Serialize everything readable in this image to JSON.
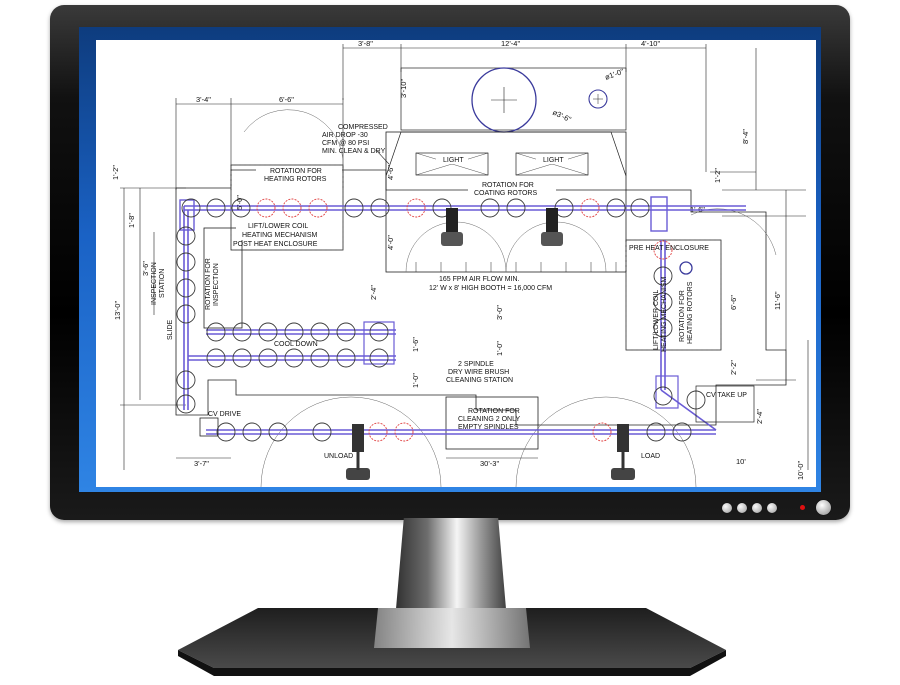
{
  "drawing": {
    "dims_top": [
      "3'-8\"",
      "12'-4\"",
      "4'-10\""
    ],
    "dims_second": [
      "3'-4\"",
      "6'-6\""
    ],
    "dims_circles": [
      "3'-10\"",
      "ø3'-6\"",
      "ø1'-0\""
    ],
    "dims_left": [
      "1'-2\"",
      "1'-8\"",
      "3'-6\"",
      "13'-0\"",
      "1'-6\"",
      "1'-0\""
    ],
    "dims_right": [
      "8'-4\"",
      "1'-2\"",
      "1'-6\"",
      "11'-6\"",
      "6'-6\"",
      "2'-2\"",
      "2'-4\"",
      "10'-0\""
    ],
    "dims_inner": [
      "5'-0\"",
      "4'-6\"",
      "4'-0\"",
      "2'-4\"",
      "3'-0\"",
      "1'-0\"",
      "10'"
    ],
    "dims_bottom": [
      "3'-7\"",
      "30'-3\""
    ],
    "compressed_air": [
      "COMPRESSED",
      "AIR DROP -30",
      "CFM @ 80 PSI",
      "MIN. CLEAN & DRY"
    ],
    "light_left": "LIGHT",
    "light_right": "LIGHT",
    "rotation_heating": [
      "ROTATION FOR",
      "HEATING ROTORS"
    ],
    "rotation_coating": [
      "ROTATION FOR",
      "COATING ROTORS"
    ],
    "lift_lower_left": [
      "LIFT/LOWER COIL",
      "HEATING MECHANISM"
    ],
    "post_heat": "POST HEAT ENCLOSURE",
    "pre_heat": "PRE HEAT ENCLOSURE",
    "airflow": [
      "165 FPM AIR FLOW MIN.",
      "12' W x 8' HIGH BOOTH = 16,000 CFM"
    ],
    "inspection_station": [
      "INSPECTION",
      "STATION"
    ],
    "rotation_inspection": [
      "ROTATION FOR",
      "INSPECTION"
    ],
    "slide": "SLIDE",
    "cool_down": "COOL DOWN",
    "lift_lower_right": [
      "LIFT/LOWER COIL",
      "HEATING MECHANISM"
    ],
    "rotation_heating_right": [
      "ROTATION FOR",
      "HEATING ROTORS"
    ],
    "dry_wire_brush": [
      "2 SPINDLE",
      "DRY WIRE BRUSH",
      "CLEANING STATION"
    ],
    "rotation_cleaning": [
      "ROTATION FOR",
      "CLEANING 2 ONLY",
      "EMPTY SPINDLES"
    ],
    "cv_drive": "CV DRIVE",
    "cv_take_up": "CV TAKE UP",
    "unload": "UNLOAD",
    "load": "LOAD"
  },
  "colors": {
    "bezel": "#000000",
    "screen_frame": "#1a62c5",
    "conveyor": "#6a5cd6",
    "heating_circle": "#e04040",
    "spindle_circle": "#3a3a9c",
    "power_led": "#e01010"
  }
}
